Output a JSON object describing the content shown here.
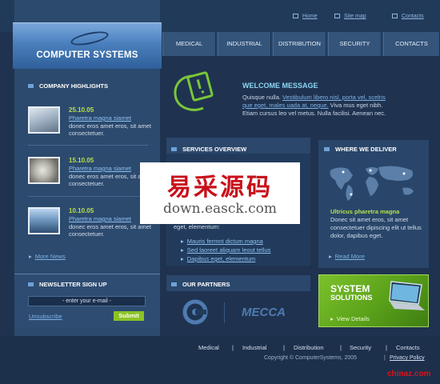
{
  "top_links": [
    {
      "label": "Home"
    },
    {
      "label": "Site map"
    },
    {
      "label": "Contacts"
    }
  ],
  "logo": {
    "title": "COMPUTER SYSTEMS"
  },
  "nav": [
    {
      "label": "MEDICAL"
    },
    {
      "label": "INDUSTRIAL"
    },
    {
      "label": "DISTRIBUTION"
    },
    {
      "label": "SECURITY"
    },
    {
      "label": "CONTACTS"
    }
  ],
  "highlights": {
    "title": "COMPANY HIGHLIGHTS",
    "items": [
      {
        "date": "25.10.05",
        "link": "Pharetra magna siamet",
        "text": "donec eros amet eros, sit amet consectetuer."
      },
      {
        "date": "15.10.05",
        "link": "Pharetra magna siamet",
        "text": "donec eros amet eros, sit amet consectetuer."
      },
      {
        "date": "10.10.05",
        "link": "Pharetra magna siamet",
        "text": "donec eros amet eros, sit amet consectetuer."
      }
    ],
    "more": "More News"
  },
  "newsletter": {
    "title": "NEWSLETTER SIGN UP",
    "placeholder": "- enter your e-mail -",
    "unsubscribe": "Unsubscribe",
    "submit": "Submit"
  },
  "welcome": {
    "title": "WELCOME MESSAGE",
    "line1_plain": "Quisque nulla. ",
    "line1_link": "Vestibulum libero nisl, porta vel, scelris",
    "line2_link": "que eget, males uada at, neque.",
    "line2_plain": " Viva mus eget nibh.",
    "line3": "Etiam cursus leo vel metus. Nulla facilisi. Aenean nec."
  },
  "services": {
    "title": "SERVICES OVERVIEW",
    "text_tail": "eget, elementum:",
    "links": [
      "Mauris fermnt dictum magna",
      "Sed laoreet aliquam leout tellus",
      "Dapibus eget, elementum"
    ]
  },
  "deliver": {
    "title": "WHERE WE DELIVER",
    "subtitle": "Ultricus pharetra magna",
    "text": "Donec sit amet eros, sit amet consectetuer dipiscing elit ut tellus dolor, dapibus eget.",
    "more": "Read More"
  },
  "partners": {
    "title": "OUR PARTNERS",
    "partner2": "MECCA"
  },
  "system": {
    "line1": "SYSTEM",
    "line2": "SOLUTIONS",
    "details": "View Details"
  },
  "footer": {
    "links": [
      "Medical",
      "Industrial",
      "Distribution",
      "Security",
      "Contacts"
    ],
    "copyright": "Copyright © ComputerSystems, 2005",
    "privacy": "Privacy Policy"
  },
  "watermark": {
    "cn": "易采源码",
    "url": "down.easck.com"
  },
  "corner": "chinaz.com",
  "colors": {
    "accent_green": "#8bc324",
    "date_green": "#b7e04a",
    "title_cyan": "#8ed6f5",
    "link_blue": "#8cc0f0"
  }
}
